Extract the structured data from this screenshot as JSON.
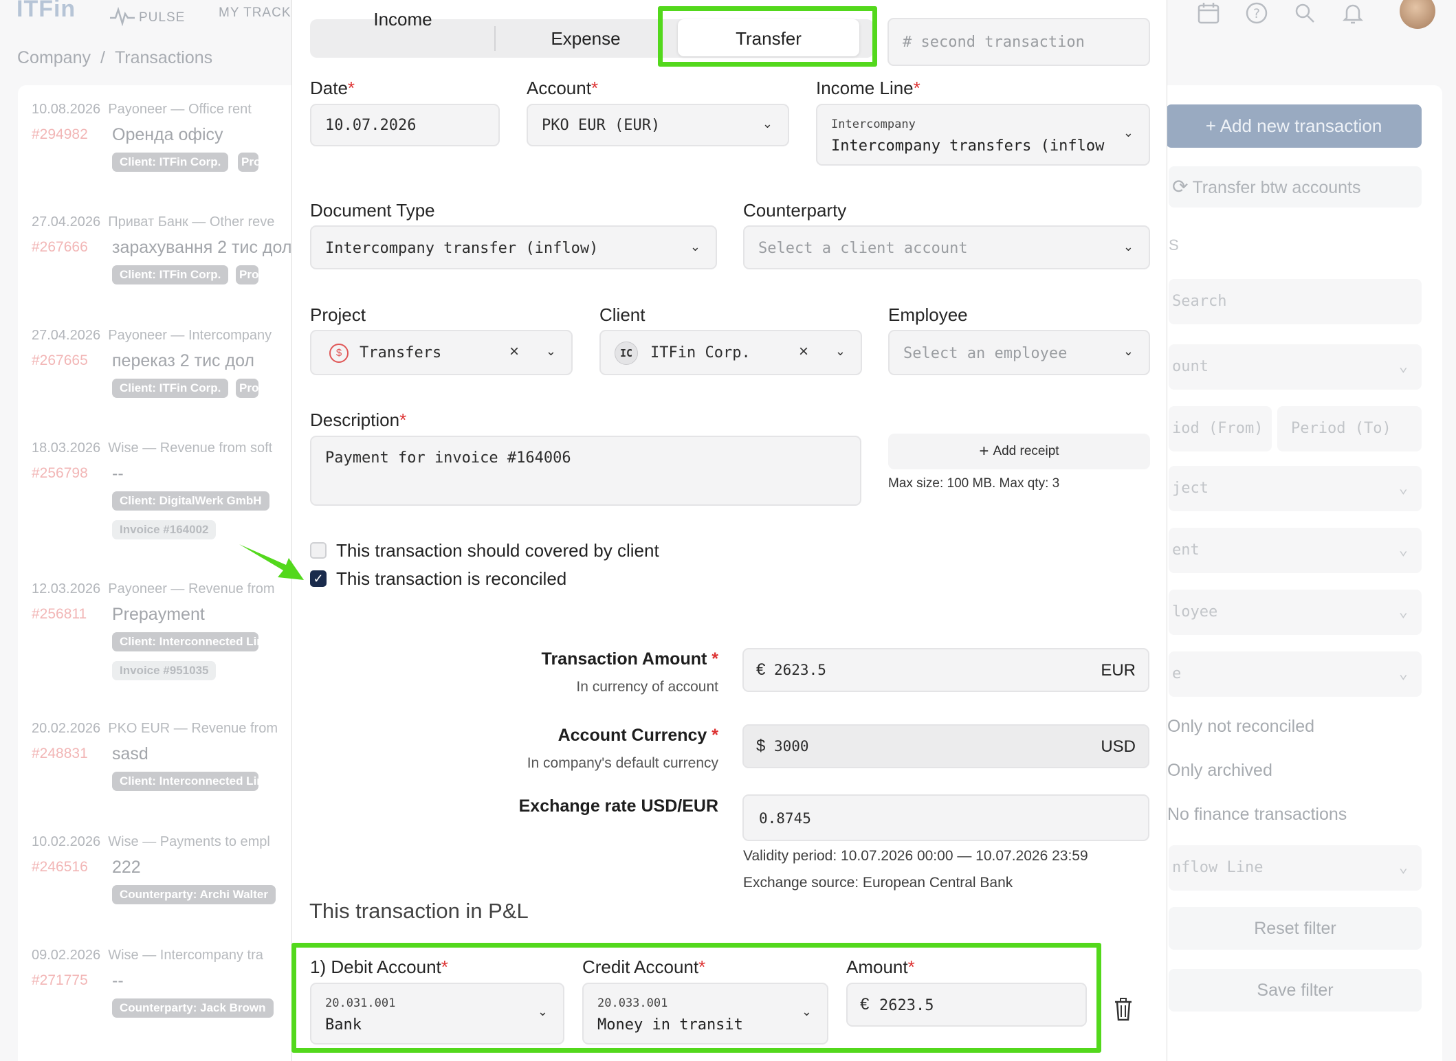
{
  "app": {
    "logo": "ITFin",
    "nav": [
      "PULSE",
      "MY TRACKE"
    ]
  },
  "breadcrumb": {
    "root": "Company",
    "sep": "/",
    "current": "Transactions"
  },
  "list": [
    {
      "date": "10.08.2026",
      "account": "Payoneer — Office rent",
      "id": "#294982",
      "desc": "Оренда офісу",
      "pills": [
        "Client: ITFin Corp.",
        "Project:"
      ]
    },
    {
      "date": "27.04.2026",
      "account": "Приват Банк — Other reve",
      "id": "#267666",
      "desc": "зарахування 2 тис дол",
      "pills": [
        "Client: ITFin Corp.",
        "Project:"
      ]
    },
    {
      "date": "27.04.2026",
      "account": "Payoneer — Intercompany",
      "id": "#267665",
      "desc": "переказ 2 тис дол",
      "pills": [
        "Client: ITFin Corp.",
        "Project:"
      ]
    },
    {
      "date": "18.03.2026",
      "account": "Wise — Revenue from soft",
      "id": "#256798",
      "desc": "--",
      "pills": [
        "Client: DigitalWerk GmbH"
      ],
      "extra": "Invoice #164002"
    },
    {
      "date": "12.03.2026",
      "account": "Payoneer — Revenue from",
      "id": "#256811",
      "desc": "Prepayment",
      "pills": [
        "Client: Interconnected Limite"
      ],
      "extra": "Invoice #951035"
    },
    {
      "date": "20.02.2026",
      "account": "PKO EUR — Revenue from",
      "id": "#248831",
      "desc": "sasd",
      "pills": [
        "Client: Interconnected Limite"
      ]
    },
    {
      "date": "10.02.2026",
      "account": "Wise — Payments to empl",
      "id": "#246516",
      "desc": "222",
      "pills": [
        "Counterparty: Archi Walter"
      ]
    },
    {
      "date": "09.02.2026",
      "account": "Wise — Intercompany tra",
      "id": "#271775",
      "desc": "--",
      "pills": [
        "Counterparty: Jack Brown"
      ]
    }
  ],
  "right": {
    "add_btn": "+ Add new transaction",
    "transfer_btn": "Transfer btw accounts",
    "section_frag": "S",
    "search": "Search",
    "account_frag": "ount",
    "period_from_frag": "iod (From)",
    "period_to": "Period (To)",
    "project_frag": "ject",
    "client_frag": "ent",
    "employee_frag": "loyee",
    "type_frag": "e",
    "opt1": "Only not reconciled",
    "opt2": "Only archived",
    "opt3": "No finance transactions",
    "inflow_frag": "nflow Line",
    "reset": "Reset filter",
    "save": "Save filter"
  },
  "form": {
    "tabs": [
      "Income",
      "Expense",
      "Transfer"
    ],
    "active_tab": "Transfer",
    "number_placeholder": "# second transaction",
    "date": {
      "label": "Date",
      "value": "10.07.2026"
    },
    "account": {
      "label": "Account",
      "value": "PKO EUR (EUR)"
    },
    "income_line": {
      "label": "Income Line",
      "group": "Intercompany",
      "value": "Intercompany transfers (inflow"
    },
    "document_type": {
      "label": "Document Type",
      "value": "Intercompany transfer (inflow)"
    },
    "counterparty": {
      "label": "Counterparty",
      "placeholder": "Select a client account"
    },
    "project": {
      "label": "Project",
      "value": "Transfers"
    },
    "client": {
      "label": "Client",
      "initials": "IC",
      "value": "ITFin Corp."
    },
    "employee": {
      "label": "Employee",
      "placeholder": "Select an employee"
    },
    "description": {
      "label": "Description",
      "value": "Payment for invoice #164006"
    },
    "receipt": {
      "button": "Add receipt",
      "hint": "Max size: 100 MB. Max qty: 3"
    },
    "checkbox_covered": {
      "label": "This transaction should covered by client",
      "checked": false
    },
    "checkbox_reconciled": {
      "label": "This transaction is reconciled",
      "checked": true
    },
    "transaction_amount": {
      "label": "Transaction Amount",
      "sub": "In currency of account",
      "symbol": "€",
      "value": "2623.5",
      "currency": "EUR"
    },
    "account_currency": {
      "label": "Account Currency",
      "sub": "In company's default currency",
      "symbol": "$",
      "value": "3000",
      "currency": "USD"
    },
    "exchange_rate": {
      "label": "Exchange rate USD/EUR",
      "value": "0.8745",
      "validity": "Validity period: 10.07.2026 00:00 — 10.07.2026 23:59",
      "source": "Exchange source: European Central Bank"
    },
    "pnl_title": "This transaction in P&L",
    "pnl": {
      "debit_label": "1) Debit Account",
      "debit_code": "20.031.001",
      "debit_name": "Bank",
      "credit_label": "Credit Account",
      "credit_code": "20.033.001",
      "credit_name": "Money in transit",
      "amount_label": "Amount",
      "amount_symbol": "€",
      "amount_value": "2623.5"
    }
  },
  "colors": {
    "highlight": "#53d81c",
    "required": "#dd3333",
    "checkbox": "#1a2b4c",
    "primary_btn": "#99aac1"
  },
  "icons": [
    "pulse-icon",
    "calendar-icon",
    "help-icon",
    "search-icon",
    "bell-icon",
    "chevron-down-icon",
    "clear-icon",
    "plus-icon",
    "refresh-icon",
    "trash-icon",
    "check-icon",
    "arrow-icon"
  ]
}
